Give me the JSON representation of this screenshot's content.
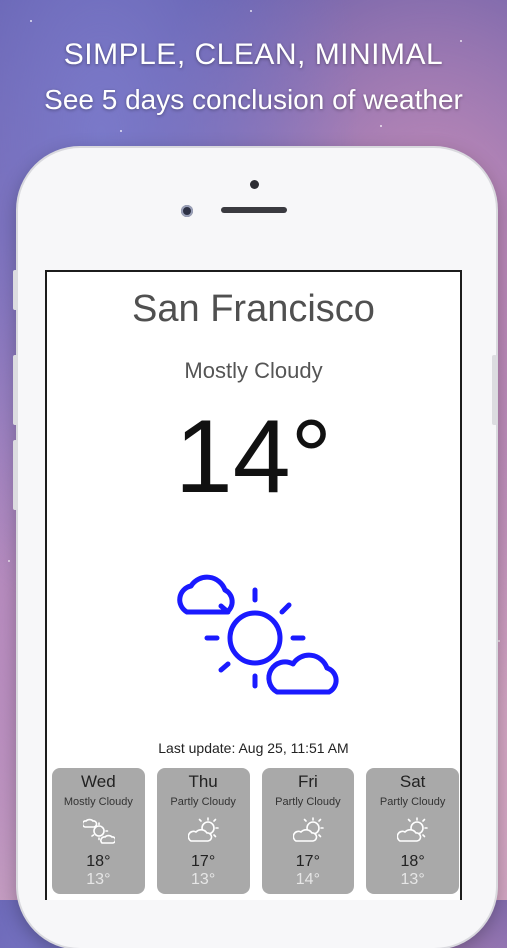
{
  "promo": {
    "headline": "SIMPLE, CLEAN, MINIMAL",
    "subheadline": "See 5 days conclusion of weather"
  },
  "weather": {
    "city": "San Francisco",
    "condition": "Mostly Cloudy",
    "temperature": "14°",
    "icon": "sun-with-clouds-icon",
    "last_update": "Last update: Aug 25, 11:51 AM"
  },
  "forecast": [
    {
      "day": "Wed",
      "condition": "Mostly Cloudy",
      "high": "18°",
      "low": "13°",
      "icon": "mostly-cloudy-icon"
    },
    {
      "day": "Thu",
      "condition": "Partly Cloudy",
      "high": "17°",
      "low": "13°",
      "icon": "partly-cloudy-icon"
    },
    {
      "day": "Fri",
      "condition": "Partly Cloudy",
      "high": "17°",
      "low": "14°",
      "icon": "partly-cloudy-icon"
    },
    {
      "day": "Sat",
      "condition": "Partly Cloudy",
      "high": "18°",
      "low": "13°",
      "icon": "partly-cloudy-icon"
    }
  ],
  "colors": {
    "icon_blue": "#1a1aff",
    "card_gray": "#a9a9a9"
  }
}
